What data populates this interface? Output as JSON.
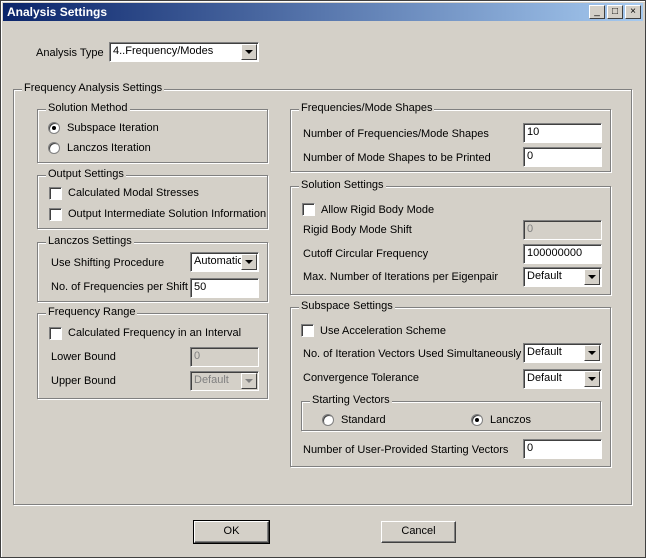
{
  "window": {
    "title": "Analysis Settings",
    "minimize_icon": "minimize-icon",
    "maximize_icon": "maximize-icon",
    "close_icon": "close-icon"
  },
  "analysis_type": {
    "label": "Analysis Type",
    "value": "4..Frequency/Modes"
  },
  "freq_group": {
    "title": "Frequency Analysis Settings"
  },
  "solution_method": {
    "title": "Solution Method",
    "options": [
      "Subspace Iteration",
      "Lanczos Iteration"
    ],
    "selected": "Subspace Iteration"
  },
  "output_settings": {
    "title": "Output Settings",
    "calc_modal_stresses": "Calculated Modal Stresses",
    "output_intermediate": "Output Intermediate Solution Information"
  },
  "lanczos_settings": {
    "title": "Lanczos Settings",
    "shifting_label": "Use Shifting Procedure",
    "shifting_value": "Automatic",
    "freq_per_shift_label": "No. of Frequencies per Shift",
    "freq_per_shift_value": "50"
  },
  "frequency_range": {
    "title": "Frequency Range",
    "calc_interval": "Calculated Frequency in an Interval",
    "lower_label": "Lower Bound",
    "lower_value": "0",
    "upper_label": "Upper Bound",
    "upper_value": "Default"
  },
  "freq_mode_shapes": {
    "title": "Frequencies/Mode Shapes",
    "num_label": "Number of Frequencies/Mode Shapes",
    "num_value": "10",
    "printed_label": "Number of Mode Shapes to be Printed",
    "printed_value": "0"
  },
  "solution_settings": {
    "title": "Solution Settings",
    "rigid_body": "Allow Rigid Body Mode",
    "rigid_shift_label": "Rigid Body Mode Shift",
    "rigid_shift_value": "0",
    "cutoff_label": "Cutoff Circular Frequency",
    "cutoff_value": "100000000",
    "max_iter_label": "Max. Number of Iterations per Eigenpair",
    "max_iter_value": "Default"
  },
  "subspace_settings": {
    "title": "Subspace Settings",
    "accel": "Use Acceleration Scheme",
    "iter_vectors_label": "No. of Iteration Vectors Used Simultaneously",
    "iter_vectors_value": "Default",
    "convergence_label": "Convergence Tolerance",
    "convergence_value": "Default",
    "starting_vectors_title": "Starting Vectors",
    "sv_options": [
      "Standard",
      "Lanczos"
    ],
    "sv_selected": "Lanczos",
    "user_vectors_label": "Number of User-Provided Starting Vectors",
    "user_vectors_value": "0"
  },
  "buttons": {
    "ok": "OK",
    "cancel": "Cancel"
  }
}
